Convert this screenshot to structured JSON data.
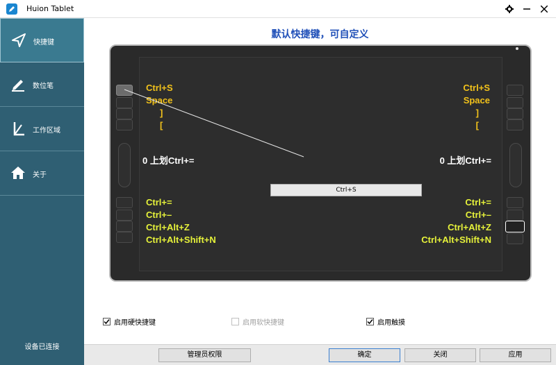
{
  "window": {
    "title": "Huion Tablet"
  },
  "sidebar": {
    "items": [
      {
        "label": "快捷键",
        "icon": "send-arrow-icon",
        "active": true
      },
      {
        "label": "数位笔",
        "icon": "pen-icon",
        "active": false
      },
      {
        "label": "工作区域",
        "icon": "work-area-icon",
        "active": false
      },
      {
        "label": "关于",
        "icon": "home-icon",
        "active": false
      }
    ],
    "status": "设备已连接"
  },
  "main": {
    "heading": "默认快捷键，可自定义",
    "left_keys_top": [
      "Ctrl+S",
      "Space",
      "]",
      "["
    ],
    "right_keys_top": [
      "Ctrl+S",
      "Space",
      "]",
      "["
    ],
    "left_ring": "0  上划Ctrl+=",
    "right_ring": "0  上划Ctrl+=",
    "left_keys_bottom": [
      "Ctrl+=",
      "Ctrl+–",
      "Ctrl+Alt+Z",
      "Ctrl+Alt+Shift+N"
    ],
    "right_keys_bottom": [
      "Ctrl+=",
      "Ctrl+–",
      "Ctrl+Alt+Z",
      "Ctrl+Alt+Shift+N"
    ],
    "key_input_value": "Ctrl+S"
  },
  "options": {
    "hard_keys": {
      "label": "启用硬快捷键",
      "checked": true
    },
    "soft_keys": {
      "label": "启用软快捷键",
      "checked": false,
      "disabled": true
    },
    "touch": {
      "label": "启用触摸",
      "checked": true
    }
  },
  "buttons": {
    "admin": "管理员权限",
    "ok": "确定",
    "close": "关闭",
    "apply": "应用"
  },
  "colors": {
    "sidebar_bg": "#2f5f73",
    "heading": "#1f4fb8",
    "key_label_yellow": "#f2c21b",
    "key_label_lime": "#e6f23a"
  }
}
